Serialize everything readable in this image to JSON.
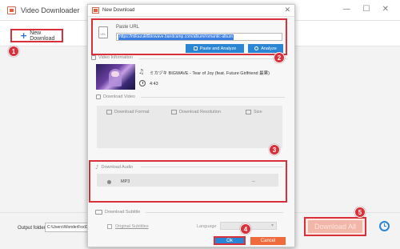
{
  "app": {
    "title": "Video Downloader",
    "new_download_label": "New Download",
    "output_folder_label": "Output folder:",
    "output_folder_value": "C:\\Users\\WonderFox\\Do",
    "download_all_label": "Download All"
  },
  "dialog": {
    "title": "New Download",
    "paste_url_label": "Paste URL",
    "url_value": "https://mikazuki6biowave.bandcamp.com/album/romantic-album",
    "url_icon_text": "URL",
    "paste_and_analyze_label": "Paste and Analyze",
    "analyze_label": "Analyze",
    "video_info_title": "Video Information",
    "track_title": "ミカヅキ BIGWAVE - Tear of Joy (feat. Future Girlfriend 最果)",
    "duration": "4:43",
    "download_video_title": "Download Video",
    "video_options": [
      "Download Format",
      "Download Resolution",
      "Size"
    ],
    "download_audio_title": "Download Audio",
    "audio_format": "MP3",
    "audio_size": "--",
    "download_subtitle_title": "Download Subtitle",
    "original_subtitles_label": "Original Subtitles",
    "language_label": "Language",
    "ok_label": "Ok",
    "cancel_label": "Cancel"
  },
  "badges": [
    "1",
    "2",
    "3",
    "4",
    "5"
  ],
  "colors": {
    "highlight_red": "#d9303a",
    "primary_blue": "#2a86d4",
    "cancel_orange": "#f06a3b",
    "download_all_disabled": "#f2b6a8"
  }
}
